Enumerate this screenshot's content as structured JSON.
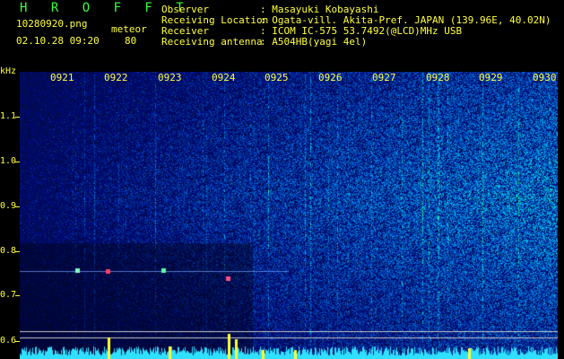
{
  "app": {
    "title": "H R O F F T"
  },
  "file": {
    "name": "10280920.png",
    "datetime": "02.10.28 09:20"
  },
  "meteor": {
    "label": "meteor",
    "count": "80"
  },
  "info": [
    {
      "label": "Observer",
      "value": ": Masayuki Kobayashi"
    },
    {
      "label": "Receiving Location",
      "value": ": Ogata-vill. Akita-Pref. JAPAN (139.96E, 40.02N)"
    },
    {
      "label": "Receiver",
      "value": ": ICOM IC-575 53.7492(@LCD)MHz USB"
    },
    {
      "label": "Receiving antenna",
      "value": ": A504HB(yagi 4el)"
    }
  ],
  "axis": {
    "unit": "kHz",
    "y_ticks": [
      "1.1",
      "1.0",
      "0.9",
      "0.8",
      "0.7",
      "0.6"
    ],
    "x_ticks": [
      "0921",
      "0922",
      "0923",
      "0924",
      "0925",
      "0926",
      "0927",
      "0928",
      "0929",
      "0930"
    ]
  },
  "colors": {
    "text": "#ffff3c",
    "title": "#38ff38",
    "background": "#000000",
    "spectrum_base": "#0a1e8c"
  }
}
